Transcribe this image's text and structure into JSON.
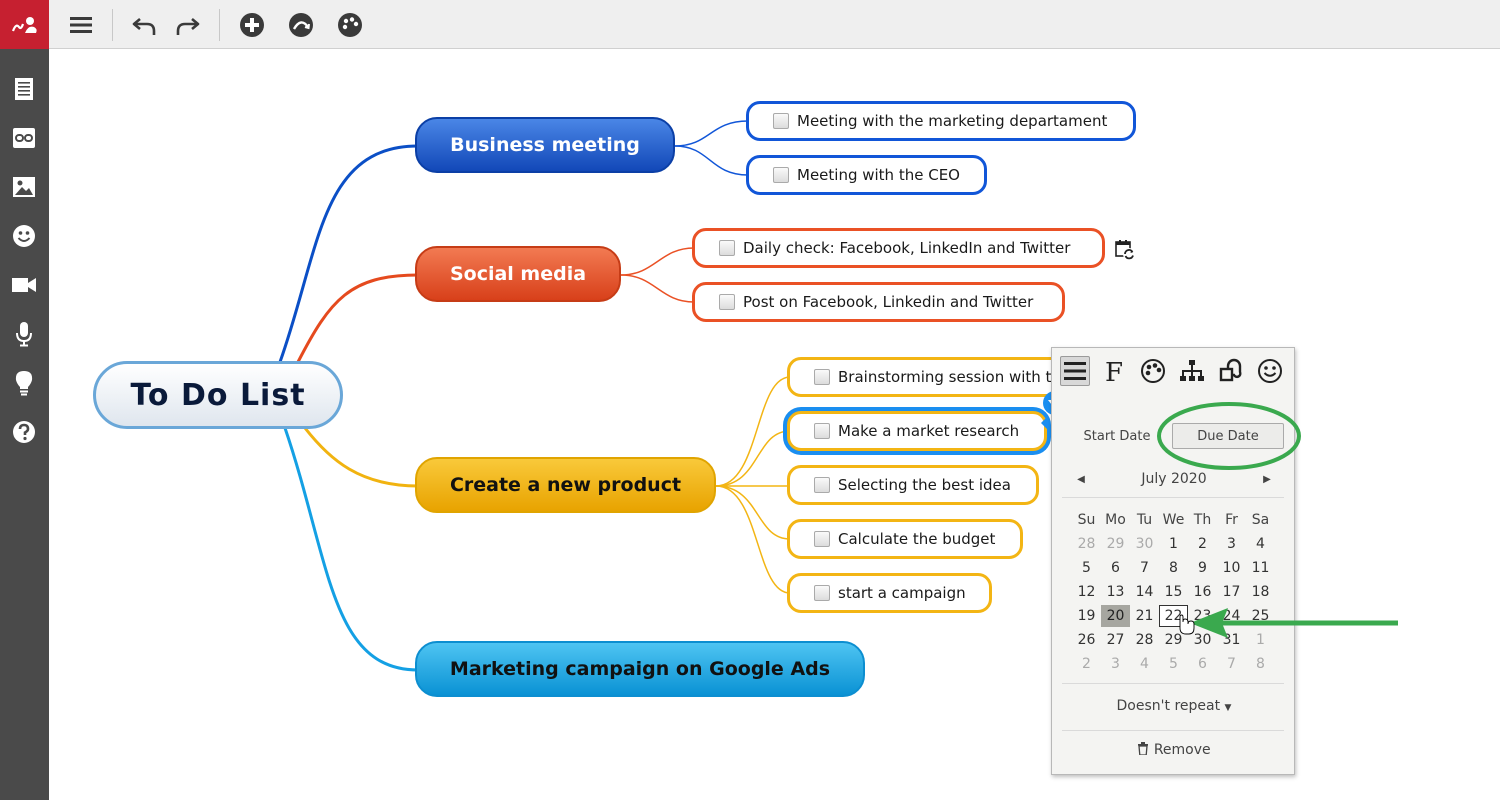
{
  "toolbar": {
    "logo": "mindomo-logo",
    "buttons": [
      "menu-icon",
      "undo-icon",
      "redo-icon",
      "add-topic-icon",
      "relationship-icon",
      "style-palette-icon"
    ]
  },
  "sidebar": {
    "items": [
      "notes-icon",
      "link-icon",
      "image-icon",
      "emoji-icon",
      "video-icon",
      "audio-icon",
      "idea-icon",
      "help-icon"
    ]
  },
  "map": {
    "root": "To Do List",
    "branches": [
      {
        "label": "Business meeting",
        "color": "#1156d8",
        "tasks": [
          "Meeting with the marketing departament",
          "Meeting with the CEO"
        ]
      },
      {
        "label": "Social media",
        "color": "#ea5125",
        "tasks": [
          "Daily check: Facebook, LinkedIn and Twitter",
          "Post on Facebook, Linkedin and Twitter"
        ]
      },
      {
        "label": "Create a new product",
        "color": "#f3b514",
        "tasks": [
          "Brainstorming session with t",
          "Make a market research",
          "Selecting the best idea",
          "Calculate the budget",
          "start a campaign"
        ]
      },
      {
        "label": "Marketing campaign on Google Ads",
        "color": "#14a0e4",
        "tasks": []
      }
    ]
  },
  "popup": {
    "tools": [
      "text-format-icon",
      "font-icon",
      "color-palette-icon",
      "structure-icon",
      "shape-icon",
      "emoji-icon"
    ],
    "tabs": {
      "start": "Start Date",
      "due": "Due Date"
    },
    "month": "July 2020",
    "weekdays": [
      "Su",
      "Mo",
      "Tu",
      "We",
      "Th",
      "Fr",
      "Sa"
    ],
    "weeks": [
      [
        "28",
        "29",
        "30",
        "1",
        "2",
        "3",
        "4"
      ],
      [
        "5",
        "6",
        "7",
        "8",
        "9",
        "10",
        "11"
      ],
      [
        "12",
        "13",
        "14",
        "15",
        "16",
        "17",
        "18"
      ],
      [
        "19",
        "20",
        "21",
        "22",
        "23",
        "24",
        "25"
      ],
      [
        "26",
        "27",
        "28",
        "29",
        "30",
        "31",
        "1"
      ],
      [
        "2",
        "3",
        "4",
        "5",
        "6",
        "7",
        "8"
      ]
    ],
    "today": "20",
    "hovered": "22",
    "repeat": "Doesn't repeat",
    "remove": "Remove"
  },
  "annotation_color": "#3aa94e"
}
